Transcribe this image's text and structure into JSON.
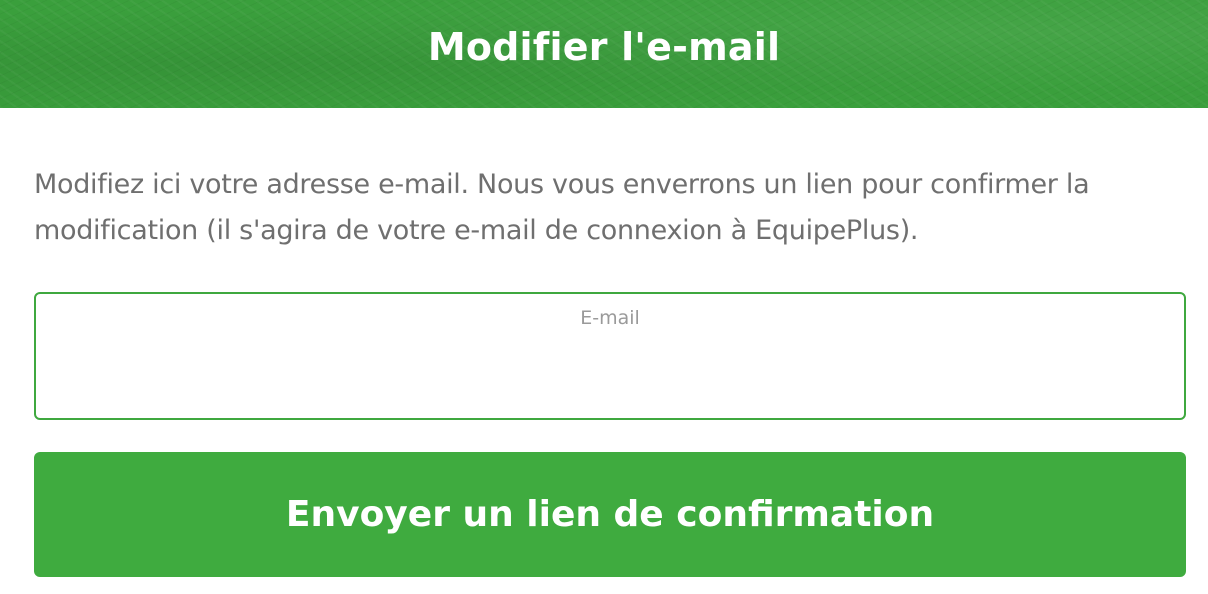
{
  "header": {
    "title": "Modifier l'e-mail"
  },
  "intro": {
    "text": "Modifiez ici votre adresse e-mail. Nous vous enverrons un lien pour confirmer la modification (il s'agira de votre e-mail de connexion à EquipePlus)."
  },
  "form": {
    "email_label": "E-mail",
    "email_value": "",
    "submit_label": "Envoyer un lien de confirmation"
  },
  "colors": {
    "brand_green": "#3fab3f",
    "header_green": "#3a9f3c",
    "text_gray": "#6f6f6f",
    "label_gray": "#9a9a9a"
  }
}
